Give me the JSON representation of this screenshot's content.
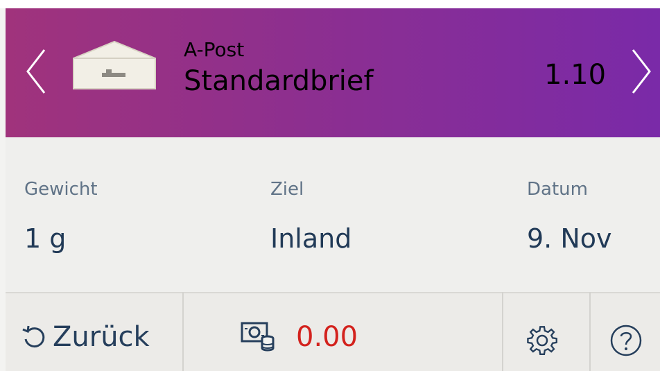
{
  "header": {
    "product_category": "A-Post",
    "product_name": "Standardbrief",
    "price": "1.10",
    "prev_icon": "chevron-left-icon",
    "next_icon": "chevron-right-icon",
    "envelope_icon": "envelope-icon"
  },
  "info": {
    "weight": {
      "label": "Gewicht",
      "value": "1 g"
    },
    "destination": {
      "label": "Ziel",
      "value": "Inland"
    },
    "date": {
      "label": "Datum",
      "value": "9. Nov"
    }
  },
  "footer": {
    "back_label": "Zurück",
    "back_icon": "undo-icon",
    "balance_icon": "money-coins-icon",
    "balance": "0.00",
    "settings_icon": "gear-icon",
    "help_icon": "help-icon"
  },
  "colors": {
    "header_gradient_start": "#a0337c",
    "header_gradient_end": "#7a2aa8",
    "text_dark_blue": "#213a57",
    "label_blue_gray": "#607387",
    "balance_red": "#d3221d"
  }
}
